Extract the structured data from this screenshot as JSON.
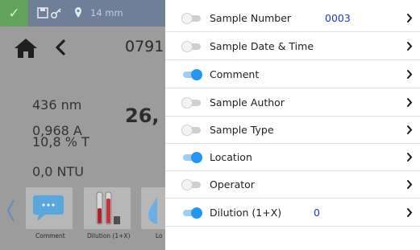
{
  "statusbar": {
    "check_icon": "check-icon",
    "status_text": "14 mm"
  },
  "header": {
    "sample_id": "0791"
  },
  "readings": {
    "wavelength": "436 nm",
    "absorbance": "0,968 A",
    "transmittance": "10,8 % T",
    "big_value": "26,",
    "turbidity": "0,0 NTU"
  },
  "toolbar": {
    "comment_label": "Comment",
    "dilution_label": "Dilution (1+X)",
    "location_label": "Lo"
  },
  "settings": [
    {
      "label": "Sample Number",
      "enabled": false,
      "value": "0003"
    },
    {
      "label": "Sample Date & Time",
      "enabled": false,
      "value": ""
    },
    {
      "label": "Comment",
      "enabled": true,
      "value": ""
    },
    {
      "label": "Sample Author",
      "enabled": false,
      "value": ""
    },
    {
      "label": "Sample Type",
      "enabled": false,
      "value": ""
    },
    {
      "label": "Location",
      "enabled": true,
      "value": ""
    },
    {
      "label": "Operator",
      "enabled": false,
      "value": ""
    },
    {
      "label": "Dilution (1+X)",
      "enabled": true,
      "value": "0"
    }
  ],
  "colors": {
    "toggle_on": "#2196f3",
    "status_ok": "#62a35c",
    "value_text": "#2236b5"
  }
}
